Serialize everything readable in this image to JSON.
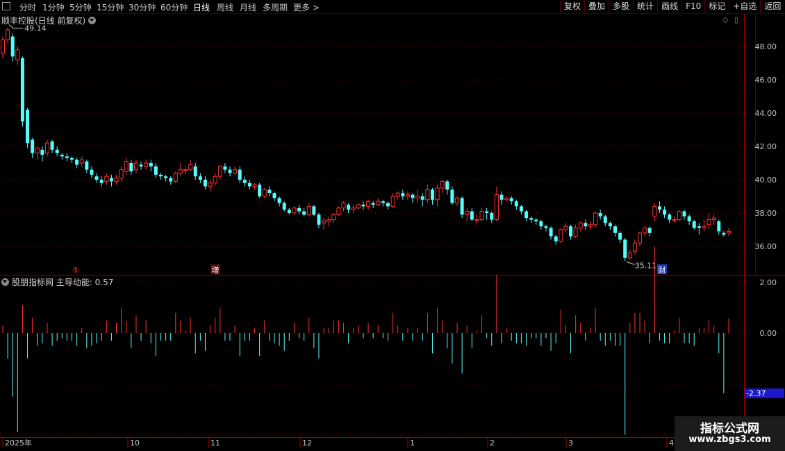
{
  "toolbar": {
    "periods": [
      {
        "label": "分时",
        "active": false
      },
      {
        "label": "1分钟",
        "active": false
      },
      {
        "label": "5分钟",
        "active": false
      },
      {
        "label": "15分钟",
        "active": false
      },
      {
        "label": "30分钟",
        "active": false
      },
      {
        "label": "60分钟",
        "active": false
      },
      {
        "label": "日线",
        "active": true
      },
      {
        "label": "周线",
        "active": false
      },
      {
        "label": "月线",
        "active": false
      },
      {
        "label": "多周期",
        "active": false
      },
      {
        "label": "更多 >",
        "active": false
      }
    ],
    "actions": [
      "复权",
      "叠加",
      "多股",
      "统计",
      "画线",
      "F10",
      "标记",
      "+自选",
      "返回"
    ]
  },
  "main_chart": {
    "title": "顺丰控股(日线 前复权)",
    "high_label": "49.14",
    "low_label": "35.11",
    "event_markers": [
      "⑤",
      "增",
      "财"
    ],
    "y_axis_labels": [
      "48.00",
      "46.00",
      "44.00",
      "42.00",
      "40.00",
      "38.00",
      "36.00"
    ]
  },
  "indicator": {
    "title": "股朋指标网 主导动能: 0.57",
    "y_axis_labels": [
      "2.00",
      "0.00",
      "-4.00"
    ],
    "current_value_label": "-2.37"
  },
  "x_axis": {
    "labels": [
      "2025年",
      "10",
      "11",
      "12",
      "1",
      "2",
      "3",
      "4"
    ]
  },
  "watermark": {
    "line1": "指标公式网",
    "line2": "www.zbgs3.com"
  },
  "colors": {
    "up": "#ff3232",
    "down": "#54fcfc",
    "grid": "#7a0000",
    "axis_text": "#c8c8c8",
    "highlight_bg": "#1a1acc"
  },
  "chart_data": {
    "type": "candlestick",
    "title": "顺丰控股(日线 前复权)",
    "ylim": [
      34.6,
      50.2
    ],
    "candles": [
      [
        47.6,
        48.4,
        47.3,
        48.6
      ],
      [
        48.4,
        49.0,
        48.2,
        49.14
      ],
      [
        48.6,
        47.4,
        47.1,
        48.8
      ],
      [
        47.2,
        47.8,
        46.9,
        48.0
      ],
      [
        47.3,
        43.5,
        43.2,
        47.4
      ],
      [
        44.2,
        42.2,
        41.9,
        44.3
      ],
      [
        42.4,
        41.6,
        41.3,
        42.5
      ],
      [
        41.6,
        41.9,
        41.2,
        42.0
      ],
      [
        41.8,
        41.5,
        41.1,
        42.0
      ],
      [
        41.6,
        42.2,
        41.4,
        42.4
      ],
      [
        42.3,
        41.8,
        41.6,
        42.4
      ],
      [
        41.8,
        41.6,
        41.4,
        42.0
      ],
      [
        41.5,
        41.4,
        41.2,
        41.6
      ],
      [
        41.4,
        41.3,
        41.1,
        41.6
      ],
      [
        41.3,
        41.2,
        41.0,
        41.4
      ],
      [
        41.2,
        40.9,
        40.7,
        41.3
      ],
      [
        41.0,
        41.2,
        40.8,
        41.4
      ],
      [
        41.1,
        40.6,
        40.4,
        41.2
      ],
      [
        40.6,
        40.3,
        40.1,
        40.8
      ],
      [
        40.2,
        40.0,
        39.8,
        40.4
      ],
      [
        40.0,
        39.8,
        39.6,
        40.2
      ],
      [
        39.9,
        40.2,
        39.7,
        40.4
      ],
      [
        40.1,
        39.9,
        39.6,
        40.3
      ],
      [
        39.9,
        40.1,
        39.7,
        40.3
      ],
      [
        40.1,
        40.6,
        39.9,
        40.8
      ],
      [
        40.5,
        41.1,
        40.3,
        41.3
      ],
      [
        41.0,
        40.5,
        40.3,
        41.2
      ],
      [
        40.6,
        41.0,
        40.4,
        41.2
      ],
      [
        40.9,
        40.8,
        40.6,
        41.1
      ],
      [
        40.8,
        41.0,
        40.6,
        41.2
      ],
      [
        41.0,
        40.8,
        40.5,
        41.2
      ],
      [
        40.8,
        40.3,
        40.1,
        41.0
      ],
      [
        40.3,
        40.2,
        40.0,
        40.4
      ],
      [
        40.2,
        40.1,
        39.9,
        40.3
      ],
      [
        40.1,
        39.9,
        39.7,
        40.2
      ],
      [
        39.9,
        40.4,
        39.8,
        40.5
      ],
      [
        40.4,
        40.6,
        40.2,
        41.0
      ],
      [
        40.6,
        40.6,
        40.3,
        40.8
      ],
      [
        40.6,
        40.9,
        40.5,
        41.2
      ],
      [
        40.8,
        40.2,
        40.0,
        41.0
      ],
      [
        40.2,
        40.0,
        39.8,
        40.4
      ],
      [
        40.0,
        39.6,
        39.4,
        40.2
      ],
      [
        39.6,
        39.8,
        39.3,
        40.0
      ],
      [
        39.8,
        40.2,
        39.6,
        40.4
      ],
      [
        40.2,
        40.8,
        40.0,
        40.9
      ],
      [
        40.8,
        40.6,
        40.4,
        41.0
      ],
      [
        40.6,
        40.4,
        40.2,
        40.8
      ],
      [
        40.4,
        40.6,
        40.3,
        40.8
      ],
      [
        40.6,
        40.0,
        39.8,
        40.8
      ],
      [
        40.0,
        39.8,
        39.6,
        40.2
      ],
      [
        39.8,
        39.6,
        39.4,
        40.0
      ],
      [
        39.6,
        39.7,
        39.4,
        39.8
      ],
      [
        39.7,
        39.0,
        38.9,
        39.8
      ],
      [
        39.0,
        39.4,
        38.9,
        39.5
      ],
      [
        39.4,
        39.2,
        39.0,
        39.6
      ],
      [
        39.2,
        38.9,
        38.7,
        39.3
      ],
      [
        38.9,
        38.6,
        38.4,
        39.0
      ],
      [
        38.6,
        38.2,
        38.1,
        38.7
      ],
      [
        38.2,
        38.0,
        37.9,
        38.3
      ],
      [
        38.0,
        38.3,
        37.9,
        38.4
      ],
      [
        38.3,
        38.1,
        37.9,
        38.5
      ],
      [
        38.1,
        37.9,
        37.8,
        38.3
      ],
      [
        37.9,
        38.4,
        37.8,
        38.6
      ],
      [
        38.4,
        37.9,
        37.8,
        38.5
      ],
      [
        37.9,
        37.3,
        37.1,
        38.0
      ],
      [
        37.4,
        37.5,
        37.0,
        37.7
      ],
      [
        37.5,
        37.6,
        37.2,
        37.8
      ],
      [
        37.6,
        37.9,
        37.4,
        38.0
      ],
      [
        37.9,
        38.3,
        37.8,
        38.4
      ],
      [
        38.3,
        38.6,
        38.1,
        38.7
      ],
      [
        38.5,
        38.2,
        38.0,
        38.6
      ],
      [
        38.2,
        38.3,
        38.0,
        38.5
      ],
      [
        38.3,
        38.5,
        38.2,
        38.6
      ],
      [
        38.5,
        38.4,
        38.2,
        38.7
      ],
      [
        38.4,
        38.7,
        38.2,
        38.8
      ],
      [
        38.6,
        38.5,
        38.3,
        38.7
      ],
      [
        38.5,
        38.7,
        38.4,
        38.9
      ],
      [
        38.7,
        38.6,
        38.4,
        38.8
      ],
      [
        38.6,
        38.4,
        38.2,
        38.7
      ],
      [
        38.4,
        39.0,
        38.3,
        39.2
      ],
      [
        39.0,
        39.2,
        38.8,
        39.3
      ],
      [
        39.2,
        39.0,
        38.8,
        39.4
      ],
      [
        39.0,
        39.1,
        38.8,
        39.3
      ],
      [
        39.1,
        38.9,
        38.6,
        39.2
      ],
      [
        38.9,
        39.0,
        38.6,
        39.4
      ],
      [
        39.0,
        38.8,
        38.4,
        39.2
      ],
      [
        38.8,
        39.4,
        38.6,
        39.7
      ],
      [
        39.4,
        38.8,
        38.5,
        39.5
      ],
      [
        38.8,
        39.5,
        38.4,
        39.7
      ],
      [
        39.5,
        39.9,
        39.2,
        40.0
      ],
      [
        39.9,
        39.4,
        39.1,
        40.0
      ],
      [
        39.4,
        38.6,
        38.5,
        39.6
      ],
      [
        38.6,
        38.9,
        38.4,
        39.0
      ],
      [
        38.9,
        37.9,
        37.7,
        39.0
      ],
      [
        37.9,
        38.1,
        37.5,
        38.3
      ],
      [
        38.1,
        37.6,
        37.5,
        38.3
      ],
      [
        37.6,
        37.6,
        37.3,
        37.9
      ],
      [
        37.6,
        38.1,
        37.5,
        38.3
      ],
      [
        38.1,
        38.0,
        37.6,
        38.3
      ],
      [
        38.0,
        37.6,
        37.4,
        38.1
      ],
      [
        37.6,
        39.1,
        37.5,
        39.6
      ],
      [
        39.1,
        38.8,
        38.5,
        39.3
      ],
      [
        38.8,
        38.9,
        38.7,
        39.0
      ],
      [
        38.9,
        38.7,
        38.5,
        39.0
      ],
      [
        38.7,
        38.4,
        38.2,
        38.8
      ],
      [
        38.4,
        38.1,
        37.9,
        38.5
      ],
      [
        38.1,
        37.7,
        37.5,
        38.2
      ],
      [
        37.7,
        37.6,
        37.4,
        37.8
      ],
      [
        37.6,
        37.5,
        37.3,
        37.7
      ],
      [
        37.5,
        37.2,
        37.0,
        37.6
      ],
      [
        37.2,
        37.1,
        36.9,
        37.3
      ],
      [
        37.1,
        36.6,
        36.4,
        37.2
      ],
      [
        36.6,
        36.3,
        36.1,
        36.7
      ],
      [
        36.3,
        37.0,
        36.2,
        37.1
      ],
      [
        37.0,
        37.2,
        36.8,
        37.4
      ],
      [
        37.2,
        36.6,
        36.4,
        37.3
      ],
      [
        36.6,
        37.1,
        36.5,
        37.3
      ],
      [
        37.1,
        37.4,
        36.9,
        37.5
      ],
      [
        37.4,
        37.2,
        37.0,
        37.6
      ],
      [
        37.2,
        37.3,
        37.0,
        37.5
      ],
      [
        37.3,
        38.0,
        37.1,
        38.1
      ],
      [
        38.0,
        37.8,
        37.6,
        38.2
      ],
      [
        37.8,
        37.4,
        37.2,
        37.9
      ],
      [
        37.4,
        37.2,
        37.0,
        37.5
      ],
      [
        37.2,
        36.8,
        36.6,
        37.3
      ],
      [
        36.8,
        36.4,
        36.2,
        36.9
      ],
      [
        36.4,
        35.3,
        35.11,
        36.5
      ],
      [
        35.3,
        35.6,
        35.2,
        35.8
      ],
      [
        35.7,
        36.2,
        35.5,
        36.4
      ],
      [
        36.2,
        36.8,
        36.0,
        36.9
      ],
      [
        36.8,
        37.1,
        36.6,
        37.2
      ],
      [
        37.1,
        36.8,
        36.6,
        37.2
      ],
      [
        37.8,
        38.4,
        37.5,
        38.6
      ],
      [
        38.4,
        38.2,
        38.0,
        38.7
      ],
      [
        38.2,
        37.9,
        37.7,
        38.4
      ],
      [
        37.9,
        37.6,
        37.4,
        38.0
      ],
      [
        37.6,
        37.6,
        37.4,
        37.8
      ],
      [
        37.6,
        38.1,
        37.5,
        38.2
      ],
      [
        38.1,
        37.8,
        37.6,
        38.2
      ],
      [
        37.8,
        37.5,
        37.3,
        37.9
      ],
      [
        37.5,
        37.1,
        37.0,
        37.6
      ],
      [
        37.2,
        37.1,
        36.7,
        37.4
      ],
      [
        37.1,
        37.2,
        36.9,
        37.6
      ],
      [
        37.3,
        37.6,
        37.0,
        38.0
      ],
      [
        37.6,
        37.7,
        37.3,
        37.9
      ],
      [
        37.5,
        36.9,
        36.7,
        37.6
      ],
      [
        36.8,
        36.7,
        36.6,
        36.9
      ],
      [
        36.8,
        36.9,
        36.6,
        37.1
      ]
    ],
    "momentum": [
      0.3,
      -1.0,
      -2.5,
      -3.9,
      1.1,
      -1.0,
      0.6,
      -0.5,
      -0.4,
      0.4,
      -0.5,
      -0.3,
      -0.2,
      -0.3,
      -0.3,
      -0.5,
      0.2,
      -0.6,
      -0.5,
      -0.4,
      -0.3,
      0.5,
      -0.3,
      0.4,
      1.0,
      0.5,
      -0.6,
      0.7,
      -0.3,
      0.5,
      -0.4,
      -0.9,
      -0.3,
      -0.3,
      -0.3,
      0.8,
      0.5,
      0.1,
      0.6,
      -0.8,
      -0.3,
      -0.7,
      0.3,
      0.6,
      1.0,
      -0.3,
      -0.3,
      0.3,
      -0.9,
      -0.3,
      -0.3,
      0.2,
      -0.9,
      0.5,
      -0.3,
      -0.4,
      -0.5,
      -0.7,
      -0.3,
      0.4,
      -0.2,
      -0.3,
      0.6,
      -0.6,
      -1.0,
      0.2,
      0.2,
      0.5,
      0.5,
      0.4,
      -0.4,
      0.2,
      0.3,
      -0.2,
      0.4,
      -0.2,
      0.3,
      -0.2,
      -0.3,
      0.8,
      0.3,
      -0.3,
      0.2,
      -0.3,
      0.2,
      -0.3,
      0.8,
      -0.8,
      1.0,
      0.5,
      -0.6,
      -1.2,
      0.4,
      -1.6,
      0.3,
      -0.6,
      0.1,
      0.7,
      -0.2,
      -0.5,
      2.3,
      -0.4,
      0.2,
      -0.3,
      -0.4,
      -0.4,
      -0.5,
      -0.2,
      -0.2,
      -0.5,
      -0.2,
      -0.7,
      -0.4,
      0.9,
      0.3,
      -0.8,
      0.7,
      0.4,
      -0.3,
      0.2,
      1.0,
      -0.3,
      -0.5,
      -0.3,
      -0.5,
      -0.5,
      -4.0,
      0.4,
      0.8,
      0.8,
      0.5,
      -0.4,
      3.4,
      -0.3,
      -0.4,
      -0.4,
      0.1,
      0.6,
      -0.4,
      -0.4,
      -0.5,
      0.2,
      0.2,
      0.5,
      0.3,
      -0.8,
      -2.37,
      0.57
    ]
  }
}
